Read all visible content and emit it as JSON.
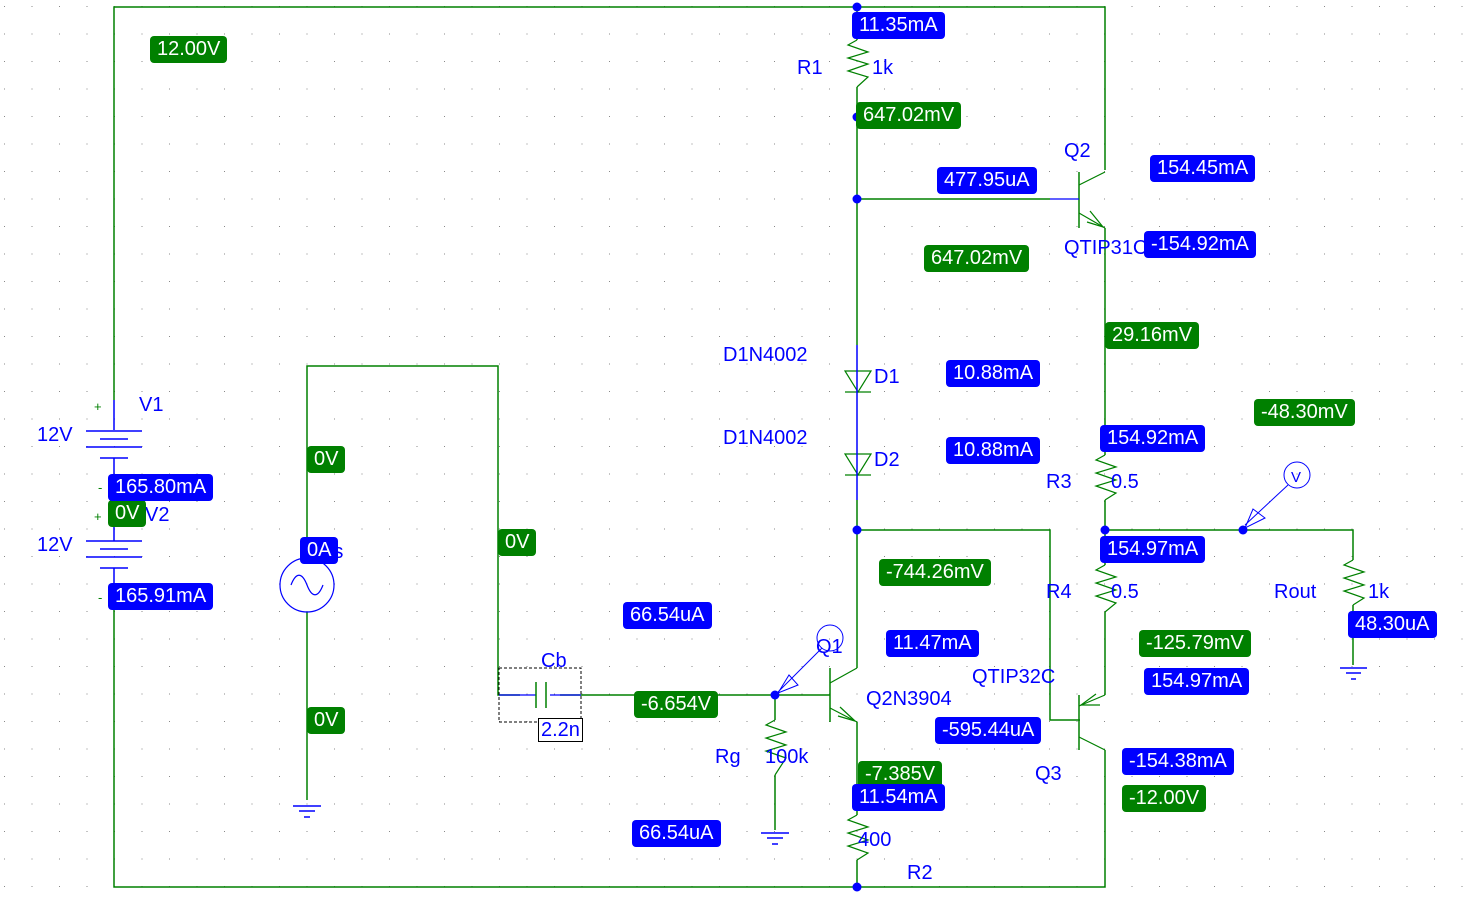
{
  "app": "PSpice Schematic - Bias Point Display",
  "colors": {
    "wire": "#008000",
    "part": "#0000ff",
    "voltage_tag": "#008000",
    "current_tag": "#0000ff",
    "grid_dot": "#888888"
  },
  "parts": {
    "V1": {
      "ref": "V1",
      "value": "12V"
    },
    "V2": {
      "ref": "V2",
      "value": "12V"
    },
    "Vs": {
      "ref": "Vs"
    },
    "R1": {
      "ref": "R1",
      "value": "1k"
    },
    "R2": {
      "ref": "R2",
      "value": "400"
    },
    "R3": {
      "ref": "R3",
      "value": "0.5"
    },
    "R4": {
      "ref": "R4",
      "value": "0.5"
    },
    "Rg": {
      "ref": "Rg",
      "value": "100k"
    },
    "Rout": {
      "ref": "Rout",
      "value": "1k"
    },
    "Cb": {
      "ref": "Cb",
      "value": "2.2n"
    },
    "D1": {
      "ref": "D1",
      "model": "D1N4002"
    },
    "D2": {
      "ref": "D2",
      "model": "D1N4002"
    },
    "Q1": {
      "ref": "Q1",
      "model": "Q2N3904"
    },
    "Q2": {
      "ref": "Q2",
      "model": "QTIP31C"
    },
    "Q3": {
      "ref": "Q3",
      "model": "QTIP32C"
    },
    "probe": {
      "label": "V"
    }
  },
  "voltages": {
    "vcc": "12.00V",
    "r1_bottom": "647.02mV",
    "q2_base": "647.02mV",
    "q2_emitter": "29.16mV",
    "out": "-48.30mV",
    "vs_top": "0V",
    "v_mid": "0V",
    "cb_left": "0V",
    "vs_bottom": "0V",
    "q3_base": "-744.26mV",
    "q1_base": "-6.654V",
    "q1_emitter": "-7.385V",
    "q3_emitter": "-125.79mV",
    "vee": "-12.00V"
  },
  "currents": {
    "r1": "11.35mA",
    "q2_base": "477.95uA",
    "q2_collector": "154.45mA",
    "q2_emitter": "-154.92mA",
    "d1": "10.88mA",
    "d2": "10.88mA",
    "r3": "154.92mA",
    "r4": "154.97mA",
    "rout": "48.30uA",
    "v1": "165.80mA",
    "v2": "165.91mA",
    "vs": "0A",
    "cb": "66.54uA",
    "rg": "66.54uA",
    "q1_collector": "11.47mA",
    "q3_base": "-595.44uA",
    "q3_emitter": "154.97mA",
    "q3_collector": "-154.38mA",
    "r2": "11.54mA"
  },
  "polarity": {
    "plus": "+",
    "minus": "-"
  }
}
